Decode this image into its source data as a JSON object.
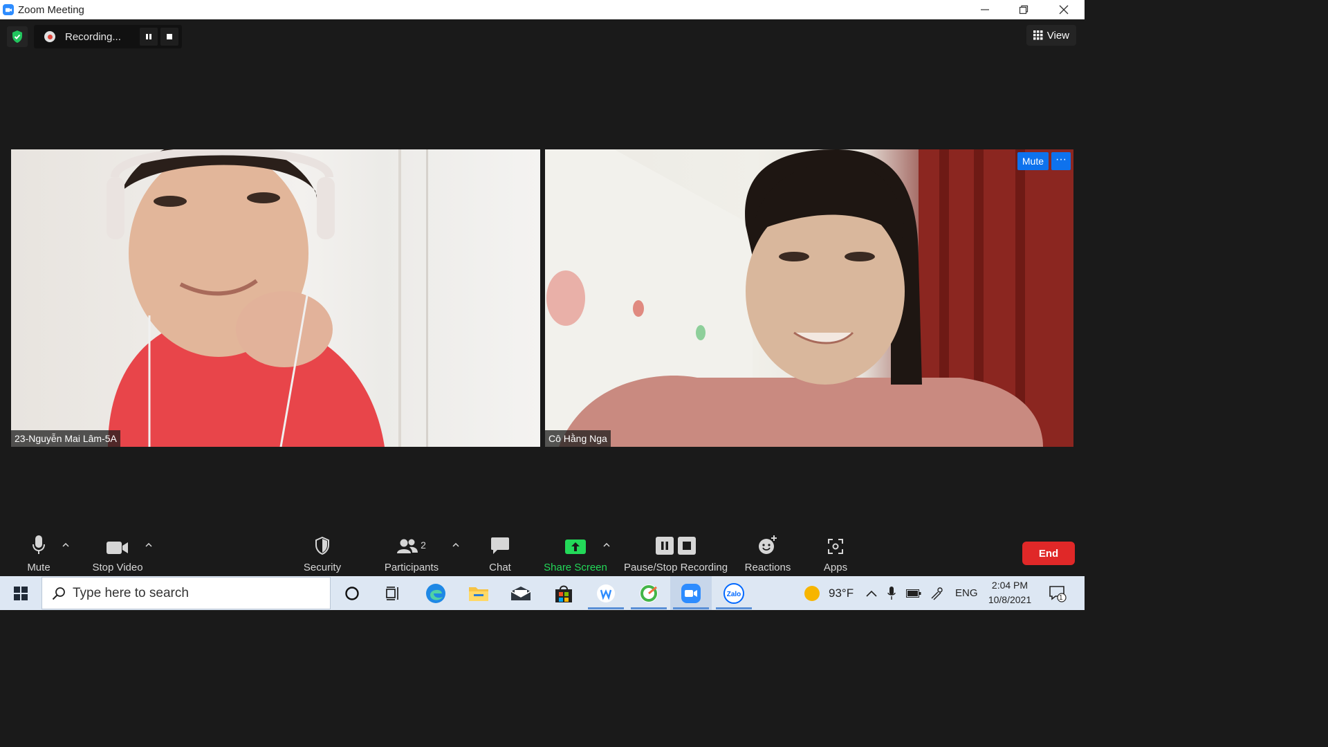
{
  "window": {
    "title": "Zoom Meeting"
  },
  "recording": {
    "status": "Recording..."
  },
  "view_button": {
    "label": "View"
  },
  "participants": [
    {
      "name": "23-Nguyễn Mai Lâm-5A"
    },
    {
      "name": "Cô Hằng Nga",
      "mute_label": "Mute",
      "more_label": "···"
    }
  ],
  "toolbar": {
    "mute": "Mute",
    "stop_video": "Stop Video",
    "security": "Security",
    "participants": "Participants",
    "participants_count": "2",
    "chat": "Chat",
    "share_screen": "Share Screen",
    "pause_stop_recording": "Pause/Stop Recording",
    "reactions": "Reactions",
    "apps": "Apps",
    "end": "End"
  },
  "taskbar": {
    "search_placeholder": "Type here to search",
    "temperature": "93°F",
    "language": "ENG",
    "time": "2:04 PM",
    "date": "10/8/2021",
    "notification_count": "1"
  },
  "colors": {
    "zoom_blue": "#2d8cff",
    "share_green": "#23d959",
    "end_red": "#e02828",
    "shield_green": "#22c55e"
  },
  "icons": [
    "zoom-app-icon",
    "shield-check-icon",
    "pause-icon",
    "stop-icon",
    "grid-icon",
    "microphone-icon",
    "video-camera-icon",
    "shield-icon",
    "people-icon",
    "chat-bubble-icon",
    "share-arrow-icon",
    "smile-plus-icon",
    "apps-icon",
    "windows-start-icon",
    "search-icon",
    "cortana-icon",
    "task-view-icon",
    "edge-icon",
    "file-explorer-icon",
    "mail-icon",
    "store-icon",
    "weather-icon",
    "chevron-up-icon",
    "battery-icon",
    "network-icon",
    "notification-icon"
  ]
}
